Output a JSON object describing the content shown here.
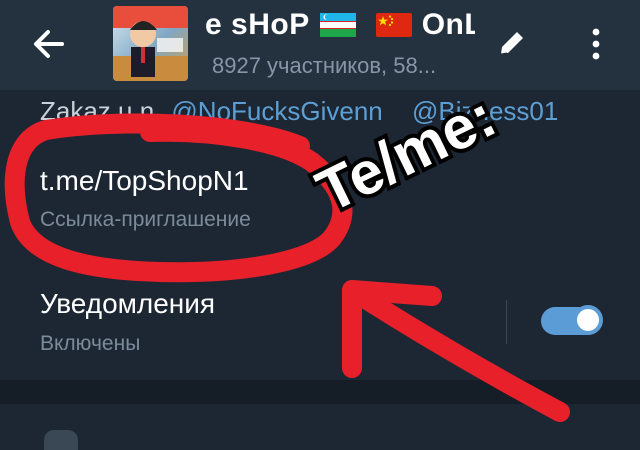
{
  "header": {
    "title_part1": "e sHoP",
    "title_part2": "OnL",
    "subtitle": "8927 участников, 58..."
  },
  "admins": {
    "prefix": "Zakaz u.n",
    "mentions": [
      "@NoFucksGivenn",
      "@Bizness01"
    ]
  },
  "invite": {
    "link": "t.me/TopShopN1",
    "label": "Ссылка-приглашение"
  },
  "notifications": {
    "label": "Уведомления",
    "status": "Включены",
    "enabled": true
  },
  "overlay": {
    "sticker_text": "Te/me:",
    "annotation_color": "#e8202a"
  },
  "colors": {
    "background": "#1d2733",
    "header": "#243240",
    "accent": "#5b9cd6",
    "link": "#5d9fd4"
  },
  "icons": [
    "back-arrow-icon",
    "pencil-icon",
    "more-vertical-icon",
    "flag-uzbekistan-icon",
    "flag-china-icon"
  ]
}
